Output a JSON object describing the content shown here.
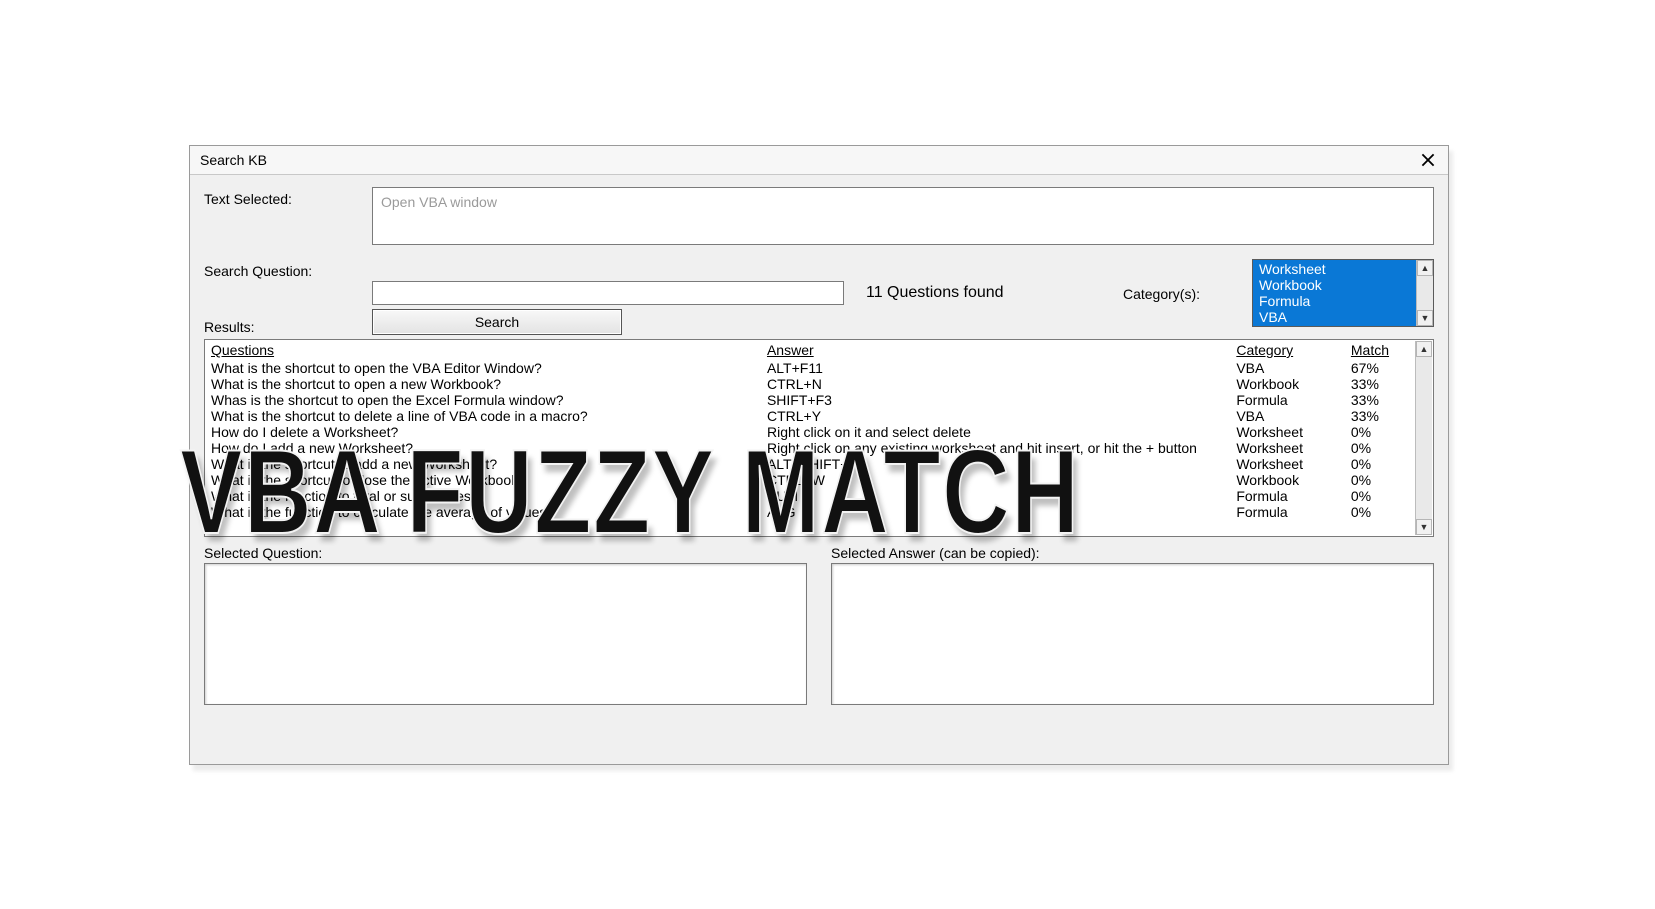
{
  "window": {
    "title": "Search KB"
  },
  "labels": {
    "text_selected": "Text Selected:",
    "search_question": "Search Question:",
    "questions_found": "11 Questions found",
    "categories": "Category(s):",
    "results": "Results:",
    "search_btn": "Search",
    "selected_question": "Selected Question:",
    "selected_answer": "Selected Answer (can be copied):"
  },
  "text_selected_value": "Open VBA window",
  "search_input_value": "",
  "categories_list": [
    "Worksheet",
    "Workbook",
    "Formula",
    "VBA"
  ],
  "results": {
    "headers": {
      "question": "Questions",
      "answer": "Answer",
      "category": "Category",
      "match": "Match"
    },
    "rows": [
      {
        "q": "What is the shortcut to open the VBA Editor Window?",
        "a": "ALT+F11",
        "c": "VBA",
        "m": "67%"
      },
      {
        "q": "What is the shortcut to open a new Workbook?",
        "a": "CTRL+N",
        "c": "Workbook",
        "m": "33%"
      },
      {
        "q": "Whas is the shortcut to open the Excel Formula window?",
        "a": "SHIFT+F3",
        "c": "Formula",
        "m": "33%"
      },
      {
        "q": "What is the shortcut to delete a line of VBA code in a macro?",
        "a": "CTRL+Y",
        "c": "VBA",
        "m": "33%"
      },
      {
        "q": "How do I delete a Worksheet?",
        "a": "Right click on it and select delete",
        "c": "Worksheet",
        "m": "0%"
      },
      {
        "q": "How do I add a new Worksheet?",
        "a": "Right click on any existing worksheet and hit insert, or hit the + button",
        "c": "Worksheet",
        "m": "0%"
      },
      {
        "q": "What is the shortcut to add a new Worksheet?",
        "a": "ALT+SHIFT+F1",
        "c": "Worksheet",
        "m": "0%"
      },
      {
        "q": "What is the shortcut to close the Active Workbook?",
        "a": "CTRL+W",
        "c": "Workbook",
        "m": "0%"
      },
      {
        "q": "What is the function to total or sum values?",
        "a": "SUM",
        "c": "Formula",
        "m": "0%"
      },
      {
        "q": "What is the function to calculate the average of values?",
        "a": "AVG",
        "c": "Formula",
        "m": "0%"
      }
    ]
  },
  "overlay_text": "VBA FUZZY MATCH"
}
